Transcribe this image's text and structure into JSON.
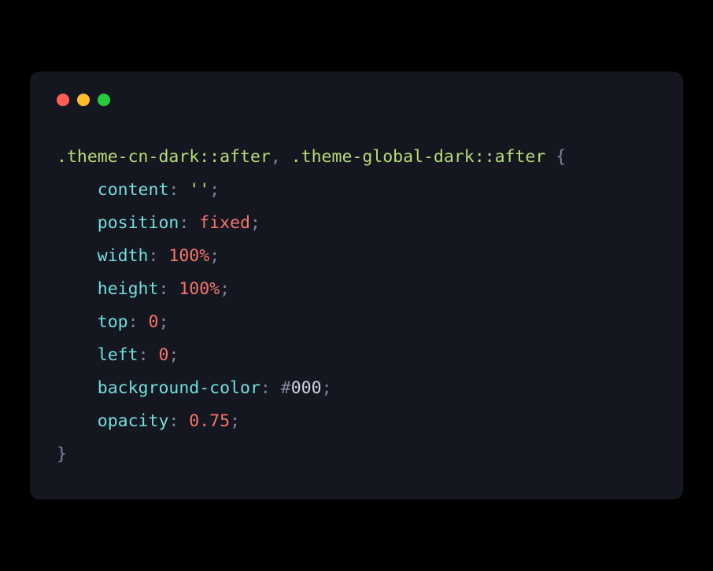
{
  "code": {
    "selector1": ".theme-cn-dark::after",
    "selector_sep": ", ",
    "selector2": ".theme-global-dark::after",
    "open_brace": " {",
    "decls": [
      {
        "prop": "content",
        "colon": ": ",
        "val": "''",
        "type": "string",
        "semi": ";"
      },
      {
        "prop": "position",
        "colon": ": ",
        "val": "fixed",
        "type": "keyword",
        "semi": ";"
      },
      {
        "prop": "width",
        "colon": ": ",
        "num": "100",
        "unit": "%",
        "type": "number-unit",
        "semi": ";"
      },
      {
        "prop": "height",
        "colon": ": ",
        "num": "100",
        "unit": "%",
        "type": "number-unit",
        "semi": ";"
      },
      {
        "prop": "top",
        "colon": ": ",
        "val": "0",
        "type": "number",
        "semi": ";"
      },
      {
        "prop": "left",
        "colon": ": ",
        "val": "0",
        "type": "number",
        "semi": ";"
      },
      {
        "prop": "background-color",
        "colon": ": ",
        "hash": "#",
        "val": "000",
        "type": "hex",
        "semi": ";"
      },
      {
        "prop": "opacity",
        "colon": ": ",
        "val": "0.75",
        "type": "number",
        "semi": ";"
      }
    ],
    "close_brace": "}",
    "indent": "    "
  }
}
